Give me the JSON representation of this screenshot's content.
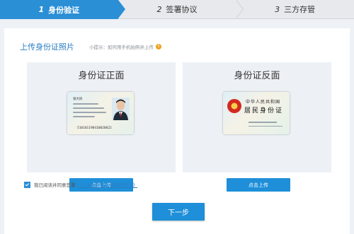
{
  "steps": [
    {
      "num": "1",
      "label": "身份验证",
      "active": true
    },
    {
      "num": "2",
      "label": "签署协议",
      "active": false
    },
    {
      "num": "3",
      "label": "三方存管",
      "active": false
    }
  ],
  "section": {
    "title": "上传身份证照片",
    "hint": "小提示：如何用手机拍照并上传"
  },
  "front": {
    "title": "身份证正面",
    "card_name": "张大民",
    "id_number": "510101198410020022",
    "upload_label": "点击上传"
  },
  "back": {
    "title": "身份证反面",
    "country": "中华人民共和国",
    "card_title": "居民身份证",
    "upload_label": "点击上传"
  },
  "agreement": {
    "text": "我已阅读并同意签署",
    "link": "《个人数字证书申请责任书》",
    "checked": true
  },
  "next_label": "下一步",
  "colors": {
    "accent": "#2b8fd6",
    "button": "#1e8fd8",
    "title_blue": "#2b7fc4"
  }
}
